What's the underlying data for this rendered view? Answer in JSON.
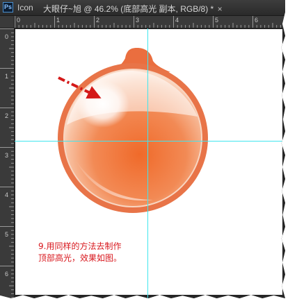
{
  "app": {
    "logo": "Ps",
    "name": "Icon"
  },
  "document": {
    "tab_title": "大眼仔~旭 @ 46.2% (底部高光 副本, RGB/8) *",
    "close_symbol": "×"
  },
  "rulers": {
    "top_labels": [
      "0",
      "1",
      "2",
      "3",
      "4",
      "5",
      "6"
    ],
    "left_labels": [
      "0",
      "1",
      "2",
      "3",
      "4",
      "5",
      "6"
    ]
  },
  "canvas": {
    "caption_lines": [
      "9.用同样的方法去制作",
      "顶部高光，效果如图。"
    ],
    "colors": {
      "ring": "#e8744a",
      "fill": "#f07a3a",
      "highlight": "#ffffff",
      "guide": "#3fe6ee",
      "arrow": "#d41919"
    },
    "icons": [
      "orange-ball-icon",
      "dash-dot-arrow-icon"
    ]
  }
}
